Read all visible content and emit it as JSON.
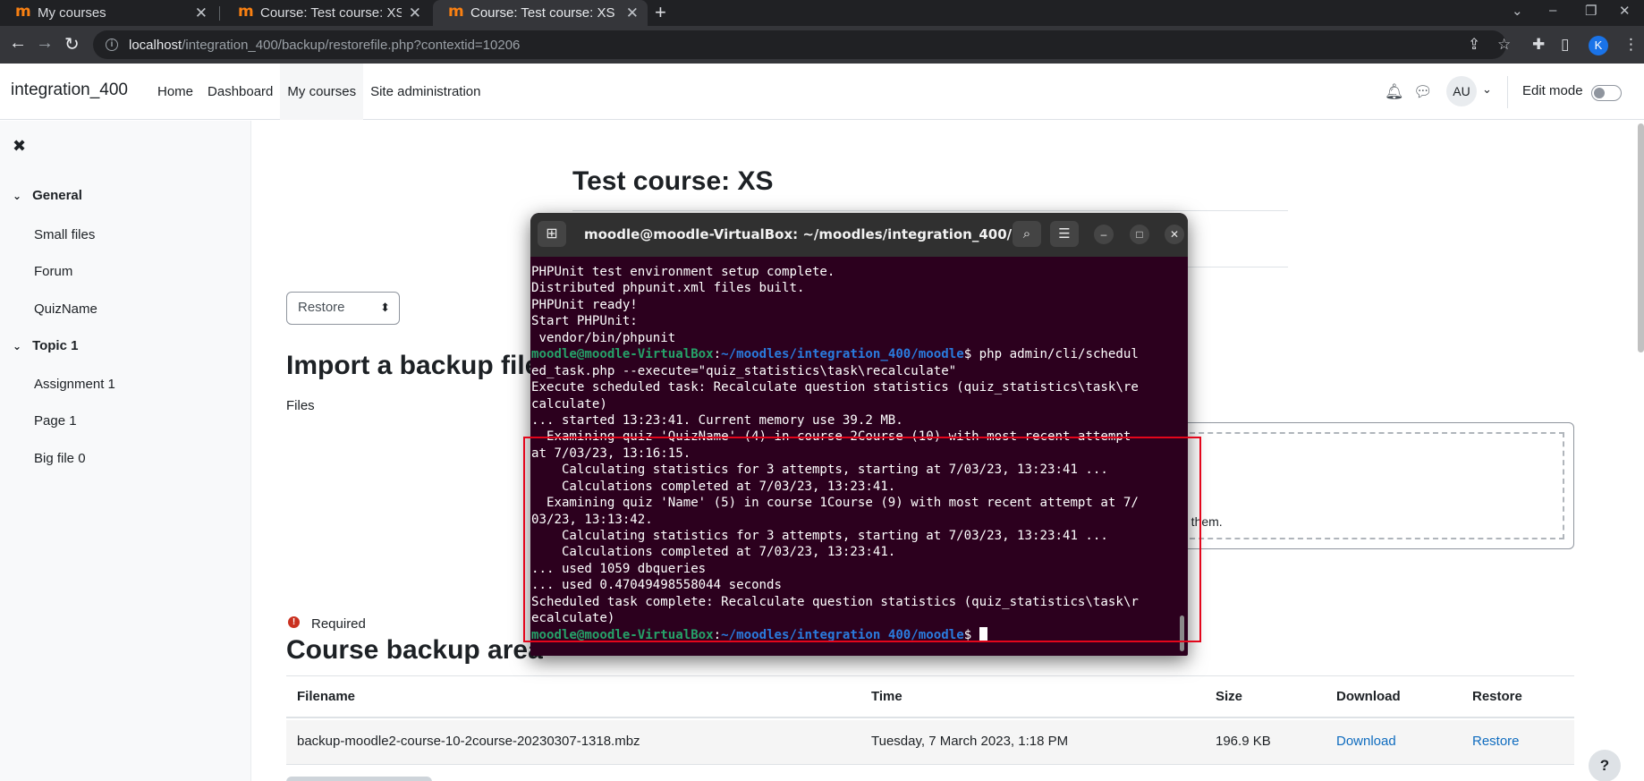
{
  "browser": {
    "tabs": [
      {
        "label": "My courses",
        "active": false
      },
      {
        "label": "Course: Test course: XS",
        "active": false
      },
      {
        "label": "Course: Test course: XS",
        "active": true
      }
    ],
    "url_host": "localhost",
    "url_path": "/integration_400/backup/restorefile.php?contextid=10206",
    "profile_initial": "K"
  },
  "navbar": {
    "site_name": "integration_400",
    "items": [
      "Home",
      "Dashboard",
      "My courses",
      "Site administration"
    ],
    "active_item": "My courses",
    "user_initials": "AU",
    "edit_mode_label": "Edit mode"
  },
  "drawer": {
    "sections": [
      {
        "title": "General",
        "items": [
          "Small files",
          "Forum",
          "QuizName"
        ]
      },
      {
        "title": "Topic 1",
        "items": [
          "Assignment 1",
          "Page 1",
          "Big file 0"
        ]
      }
    ]
  },
  "main": {
    "page_title": "Test course: XS",
    "restore_select": "Restore",
    "import_heading": "Import a backup file",
    "files_label": "Files",
    "drop_text": "d them.",
    "required_label": "Required",
    "backup_area_heading": "Course backup area",
    "table": {
      "headers": [
        "Filename",
        "Time",
        "Size",
        "Download",
        "Restore"
      ],
      "rows": [
        {
          "filename": "backup-moodle2-course-10-2course-20230307-1318.mbz",
          "time": "Tuesday, 7 March 2023, 1:18 PM",
          "size": "196.9 KB",
          "download": "Download",
          "restore": "Restore"
        }
      ]
    },
    "help_label": "?"
  },
  "terminal": {
    "title": "moodle@moodle-VirtualBox: ~/moodles/integration_400/m...",
    "prompt_user": "moodle@moodle-VirtualBox",
    "prompt_path": "~/moodles/integration_400/moodle",
    "lines": [
      "PHPUnit test environment setup complete.",
      "Distributed phpunit.xml files built.",
      "PHPUnit ready!",
      "Start PHPUnit:",
      " vendor/bin/phpunit",
      "__PROMPT__ php admin/cli/schedul",
      "ed_task.php --execute=\"quiz_statistics\\task\\recalculate\"",
      "Execute scheduled task: Recalculate question statistics (quiz_statistics\\task\\re",
      "calculate)",
      "... started 13:23:41. Current memory use 39.2 MB.",
      "  Examining quiz 'QuizName' (4) in course 2Course (10) with most recent attempt",
      "at 7/03/23, 13:16:15.",
      "    Calculating statistics for 3 attempts, starting at 7/03/23, 13:23:41 ...",
      "    Calculations completed at 7/03/23, 13:23:41.",
      "  Examining quiz 'Name' (5) in course 1Course (9) with most recent attempt at 7/",
      "03/23, 13:13:42.",
      "    Calculating statistics for 3 attempts, starting at 7/03/23, 13:23:41 ...",
      "    Calculations completed at 7/03/23, 13:23:41.",
      "... used 1059 dbqueries",
      "... used 0.47049498558044 seconds",
      "Scheduled task complete: Recalculate question statistics (quiz_statistics\\task\\r",
      "ecalculate)",
      "__PROMPT_END__"
    ]
  },
  "colors": {
    "terminal_bg": "#2c001e",
    "prompt_user": "#26a269",
    "prompt_path": "#2a7bde",
    "highlight": "#e3061b",
    "link": "#0f6cbf"
  }
}
